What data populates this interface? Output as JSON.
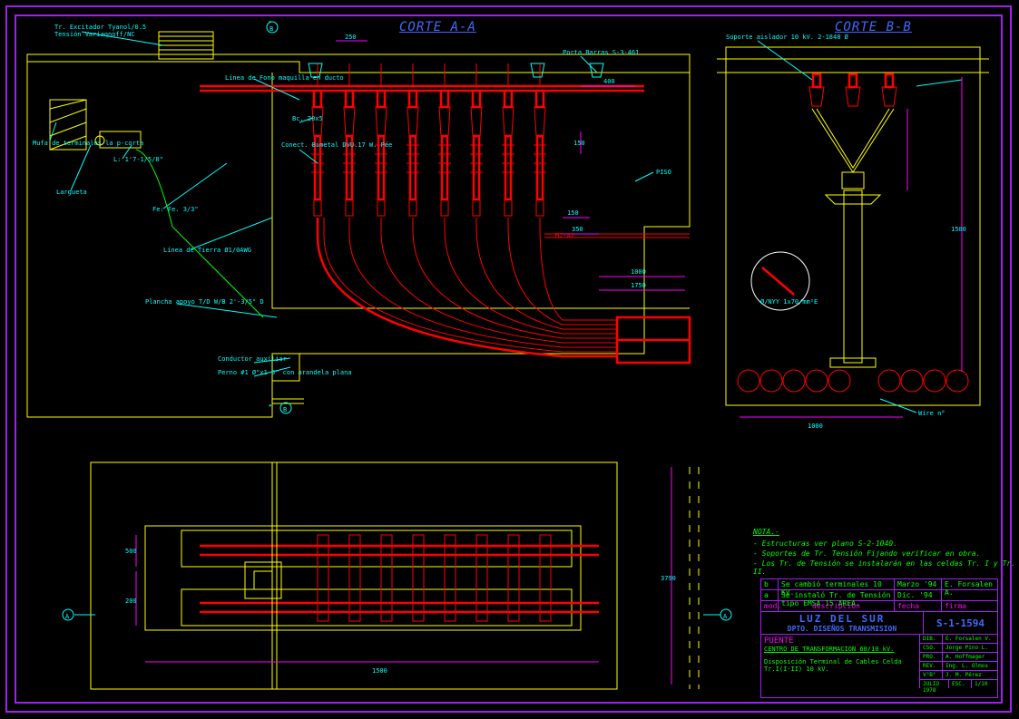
{
  "titles": {
    "corte_a": "CORTE A-A",
    "corte_b": "CORTE B-B"
  },
  "markers": {
    "a_left": "A",
    "a_right": "A",
    "b_top": "B",
    "b_bottom": "B"
  },
  "annotations": {
    "tr_excitador": "Tr. Excitador Tyanol/0.5",
    "tension": "Tensión Variaqnoff/NC",
    "linea_fono": "Línea de Fono maquilla en ducto",
    "porta_barras": "Porta Barras S-3-461",
    "mufa": "Mufa de terminales la p-corta",
    "largueta": "Largueta",
    "dim_1715": "L: 1'7-1/5/8\"",
    "fe_38": "Fe: Fe. 3/3\"",
    "bc_205": "Bc. 20x5",
    "conect": "Conect. Bimetal DVU.17 W. Pée",
    "linea_tierra": "Línea de Tierra Ø1/0AWG",
    "plancha": "Plancha apoyo T/D W/B 2'-3/5\" D",
    "conductor_auxiliar": "Conductor auxiliar",
    "perno": "Perno #1 Ø\"x1-5\" con arandela plana",
    "piso": "PISO",
    "mufa_right": "M2-A2",
    "dim_250": "250",
    "dim_400": "400",
    "dim_150": "150",
    "dim_350": "350",
    "dim_1000": "1000",
    "dim_1750": "1750",
    "dim_3790": "3790",
    "dim_500": "500",
    "dim_1500": "1500",
    "dim_200": "200",
    "soporte_aislador": "Soporte aislador 10 kV. 2-1848 Ø",
    "dim_1000b": "1000",
    "cable_nyy": "Ø/NYY 1x70/mm²E",
    "dim_1500b": "1500",
    "wire_n": "Wire n°"
  },
  "notes": {
    "title": "NOTA.-",
    "line1": "- Estructuras ver plano S-2-1040.",
    "line2": "- Soportes de Tr. Tensión Fijando verificar en obra.",
    "line3": "- Los Tr. de Tensión se instalarán en las celdas Tr. I y Tr. II."
  },
  "titleblock": {
    "rev_b": "b",
    "rev_b_desc": "Se cambió terminales 10 KV.",
    "rev_b_date": "Marzo '94",
    "rev_b_sign": "E. Forsalen A.",
    "rev_a": "a",
    "rev_a_desc": "Se instaló Tr. de Tensión tipo EMSA 15 AREA.",
    "rev_a_date": "Dic. '94",
    "rev_a_sign": "",
    "header_mod": "mod.",
    "header_desc": "descripción",
    "header_fecha": "fecha",
    "header_firma": "firma",
    "company": "LUZ DEL SUR",
    "dept": "DPTO. DISEÑOS TRANSMISION",
    "drawing_no": "S-1-1594",
    "project": "PUENTE",
    "subtitle": "CENTRO DE TRANSFORMACION 60/10 kV.",
    "description": "Disposición Terminal de Cables Celda Tr.I(I-II) 10 kV.",
    "dib": "DIB.",
    "dib_name": "E. Forsalen V.",
    "cso": "CSO.",
    "cso_name": "Jorge Pino L.",
    "pro": "PRO.",
    "pro_name": "A. Hoffmager",
    "rev": "REV.",
    "rev_name": "Ing. L. Olmos",
    "vb": "V°B°",
    "vb_name": "J. M. Pérez",
    "date": "JULIO 1978",
    "scale": "ESC.",
    "scale_val": "1/10"
  }
}
